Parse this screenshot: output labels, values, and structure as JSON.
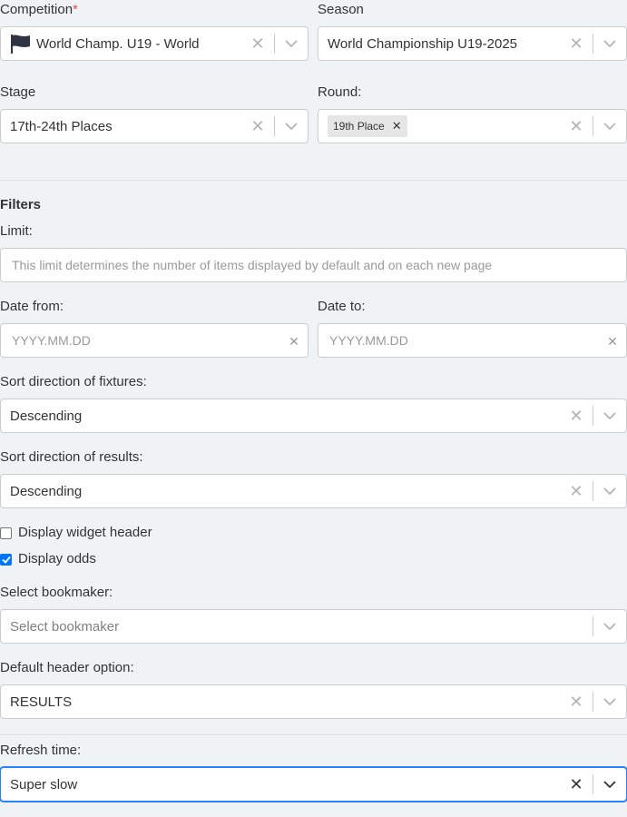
{
  "competition": {
    "label": "Competition",
    "required_mark": "*",
    "value": "World Champ. U19 - World"
  },
  "season": {
    "label": "Season",
    "value": "World Championship U19-2025"
  },
  "stage": {
    "label": "Stage",
    "value": "17th-24th Places"
  },
  "round": {
    "label": "Round:",
    "chip": "19th Place"
  },
  "filters": {
    "title": "Filters",
    "limit": {
      "label": "Limit:",
      "placeholder": "This limit determines the number of items displayed by default and on each new page"
    },
    "date_from": {
      "label": "Date from:",
      "placeholder": "YYYY.MM.DD"
    },
    "date_to": {
      "label": "Date to:",
      "placeholder": "YYYY.MM.DD"
    },
    "sort_fixtures": {
      "label": "Sort direction of fixtures:",
      "value": "Descending"
    },
    "sort_results": {
      "label": "Sort direction of results:",
      "value": "Descending"
    },
    "display_widget_header": {
      "label": "Display widget header",
      "checked": false
    },
    "display_odds": {
      "label": "Display odds",
      "checked": true
    },
    "bookmaker": {
      "label": "Select bookmaker:",
      "placeholder": "Select bookmaker"
    },
    "default_header": {
      "label": "Default header option:",
      "value": "RESULTS"
    },
    "refresh_time": {
      "label": "Refresh time:",
      "value": "Super slow"
    }
  },
  "icons": {
    "clear": "clear-icon",
    "chevron": "chevron-down-icon",
    "flag": "flag-icon",
    "check": "check-icon"
  },
  "colors": {
    "focus_border": "#2684ff",
    "checkbox_checked": "#0075ff",
    "required": "#d9534f"
  }
}
